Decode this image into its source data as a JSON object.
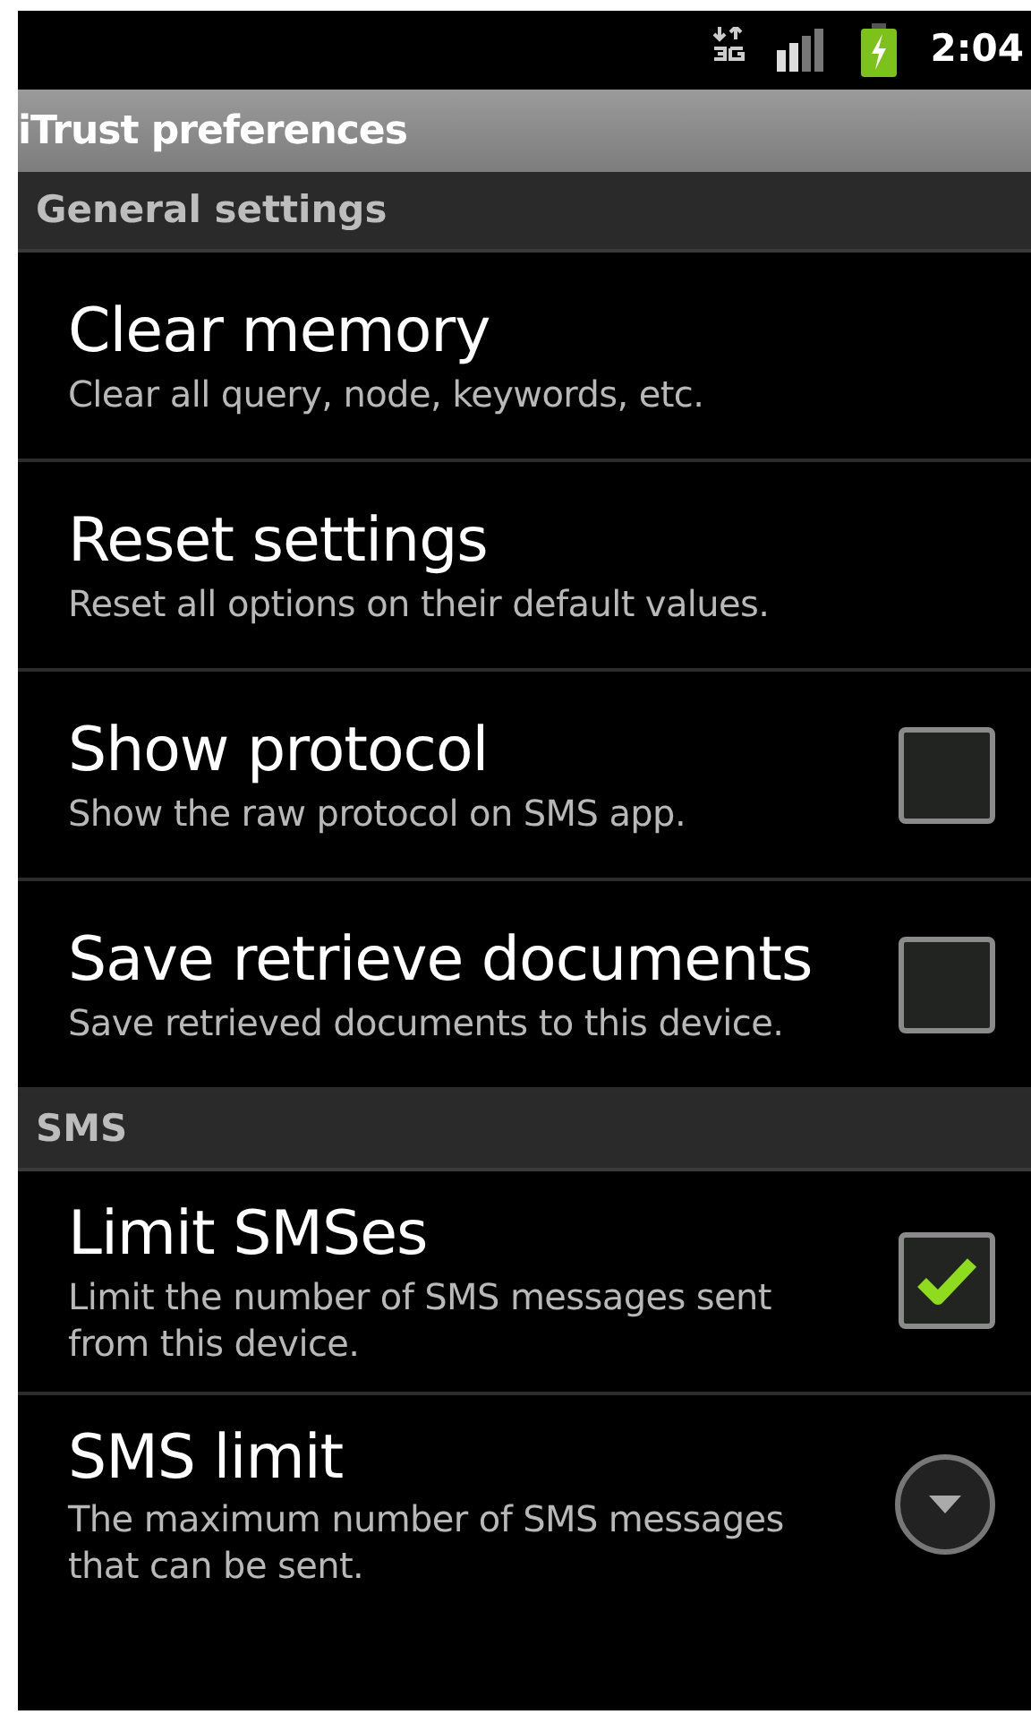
{
  "status_bar": {
    "time": "2:04",
    "battery_charging": true
  },
  "title": "iTrust preferences",
  "sections": [
    {
      "header": "General settings",
      "items": [
        {
          "kind": "plain",
          "title": "Clear memory",
          "summary": "Clear all query, node, keywords, etc."
        },
        {
          "kind": "plain",
          "title": "Reset settings",
          "summary": "Reset all options on their default values."
        },
        {
          "kind": "checkbox",
          "title": "Show protocol",
          "summary": "Show the raw protocol on SMS app.",
          "checked": false
        },
        {
          "kind": "checkbox",
          "title": "Save retrieve documents",
          "summary": "Save retrieved documents to this device.",
          "checked": false
        }
      ]
    },
    {
      "header": "SMS",
      "items": [
        {
          "kind": "checkbox",
          "title": "Limit SMSes",
          "summary": "Limit the number of SMS messages sent from this device.",
          "checked": true
        },
        {
          "kind": "list",
          "title": "SMS limit",
          "summary": "The maximum number of SMS messages that can be sent."
        }
      ]
    }
  ]
}
